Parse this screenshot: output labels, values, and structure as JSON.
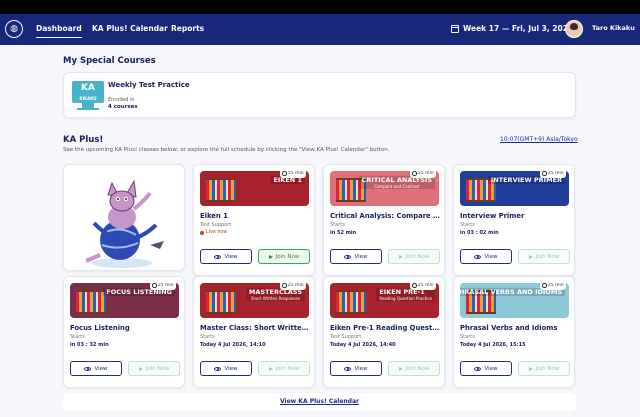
{
  "nav": {
    "items": [
      {
        "label": "Dashboard"
      },
      {
        "label": "KA Plus! Calendar"
      },
      {
        "label": "Reports"
      }
    ],
    "week": "Week 17 — Fri, Jul 3, 2026",
    "user": "Taro Kikaku"
  },
  "special": {
    "heading": "My Special Courses",
    "logo_text": "KA",
    "logo_sub": "KIKAKU",
    "course_title": "Weekly Test Practice",
    "enrolled_label": "Enrolled in",
    "enrolled_count": "4 courses"
  },
  "kaplus": {
    "heading": "KA Plus!",
    "description": "See the upcoming KA Plus! classes below, or explore the full schedule by clicking the \"View KA Plus! Calendar\" button.",
    "timezone": "10:07(GMT+9) Asia/Tokyo",
    "view_label": "View",
    "join_label": "Join Now",
    "cards": [
      {
        "banner": "EIKEN 1",
        "banner_sub": "",
        "duration": "55 min",
        "title": "Eiken 1",
        "subtitle": "Test Support",
        "status": "Live now",
        "live": true,
        "color": "#a8232c"
      },
      {
        "banner": "CRITICAL ANALYSIS",
        "banner_sub": "Compare and Contrast",
        "duration": "55 min",
        "title": "Critical Analysis: Compare and...",
        "subtitle": "Starts",
        "status": "in 52 min",
        "live": false,
        "color": "#e0707a"
      },
      {
        "banner": "INTERVIEW PRIMER",
        "banner_sub": "",
        "duration": "25 min",
        "title": "Interview Primer",
        "subtitle": "Starts",
        "status": "in 03 : 02 min",
        "live": false,
        "color": "#1f3f99"
      },
      {
        "banner": "FOCUS LISTENING",
        "banner_sub": "",
        "duration": "25 min",
        "title": "Focus Listening",
        "subtitle": "Starts",
        "status": "in 03 : 32 min",
        "live": false,
        "color": "#7b2d4a"
      },
      {
        "banner": "MASTERCLASS",
        "banner_sub": "Short Written Responses",
        "duration": "25 min",
        "title": "Master Class: Short Written R...",
        "subtitle": "Starts",
        "status": "Today 4 Jul 2026, 14:10",
        "live": false,
        "color": "#a8232c"
      },
      {
        "banner": "EIKEN PRE-1",
        "banner_sub": "Reading Question Practice",
        "duration": "25 min",
        "title": "Eiken Pre-1 Reading Question ...",
        "subtitle": "Test Support",
        "status": "Today 4 Jul 2026, 14:40",
        "live": false,
        "color": "#a8232c"
      },
      {
        "banner": "PHRASAL VERBS AND IDIOMS",
        "banner_sub": "",
        "duration": "25 min",
        "title": "Phrasal Verbs and Idioms",
        "subtitle": "Starts",
        "status": "Today 4 Jul 2026, 15:15",
        "live": false,
        "color": "#8fc8d8"
      }
    ],
    "calendar_link": "View KA Plus! Calendar"
  }
}
